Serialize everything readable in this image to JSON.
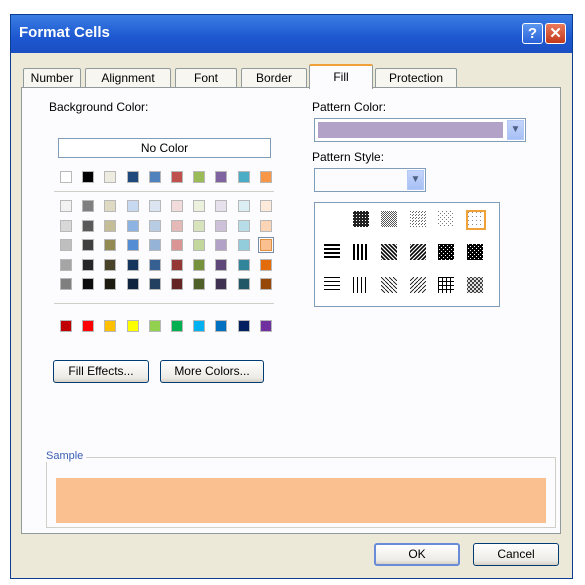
{
  "window": {
    "title": "Format Cells",
    "help_glyph": "?",
    "close_glyph": "✕"
  },
  "tabs": [
    {
      "label": "Number",
      "active": false
    },
    {
      "label": "Alignment",
      "active": false
    },
    {
      "label": "Font",
      "active": false
    },
    {
      "label": "Border",
      "active": false
    },
    {
      "label": "Fill",
      "active": true
    },
    {
      "label": "Protection",
      "active": false
    }
  ],
  "background_color": {
    "label": "Background Color:",
    "no_color_label": "No Color",
    "theme_row": [
      "#ffffff",
      "#000000",
      "#eeece1",
      "#1f497d",
      "#4f81bd",
      "#c0504d",
      "#9bbb59",
      "#8064a2",
      "#4bacc6",
      "#f79646"
    ],
    "tint_rows": [
      [
        "#f2f2f2",
        "#7f7f7f",
        "#ddd9c3",
        "#c6d9f0",
        "#dbe5f1",
        "#f2dcdb",
        "#ebf1dd",
        "#e5e0ec",
        "#dbeef3",
        "#fdeada"
      ],
      [
        "#d8d8d8",
        "#595959",
        "#c4bd97",
        "#8db3e2",
        "#b8cce4",
        "#e5b9b7",
        "#d7e3bc",
        "#ccc1d9",
        "#b7dde8",
        "#fbd5b5"
      ],
      [
        "#bfbfbf",
        "#3f3f3f",
        "#938953",
        "#548dd4",
        "#95b3d7",
        "#d99694",
        "#c3d69b",
        "#b2a2c7",
        "#92cddc",
        "#fac08f"
      ],
      [
        "#a5a5a5",
        "#262626",
        "#494429",
        "#17365d",
        "#366092",
        "#953734",
        "#76923c",
        "#5f497a",
        "#31859b",
        "#e36c09"
      ],
      [
        "#7f7f7f",
        "#0c0c0c",
        "#1d1b10",
        "#0f243e",
        "#244061",
        "#632423",
        "#4f6128",
        "#3f3151",
        "#205867",
        "#974806"
      ]
    ],
    "standard_row": [
      "#c00000",
      "#ff0000",
      "#ffc000",
      "#ffff00",
      "#92d050",
      "#00b050",
      "#00b0f0",
      "#0070c0",
      "#002060",
      "#7030a0"
    ],
    "selected": "#fac08f"
  },
  "buttons": {
    "fill_effects": "Fill Effects...",
    "more_colors": "More Colors...",
    "ok": "OK",
    "cancel": "Cancel"
  },
  "pattern_color": {
    "label": "Pattern Color:",
    "value_color": "#b2a2c7"
  },
  "pattern_style": {
    "label": "Pattern Style:",
    "rows": [
      [
        "none",
        "solid-dark-75",
        "gray-50",
        "gray-25",
        "gray-12",
        "gray-6-selected"
      ],
      [
        "dark-horizontal",
        "dark-vertical",
        "dark-down-diagonal",
        "dark-up-diagonal",
        "dark-grid",
        "dark-trellis"
      ],
      [
        "thin-horizontal",
        "thin-vertical",
        "thin-down-diagonal",
        "thin-up-diagonal",
        "thin-grid",
        "thin-trellis"
      ]
    ]
  },
  "sample": {
    "label": "Sample",
    "color": "#fac08f"
  }
}
